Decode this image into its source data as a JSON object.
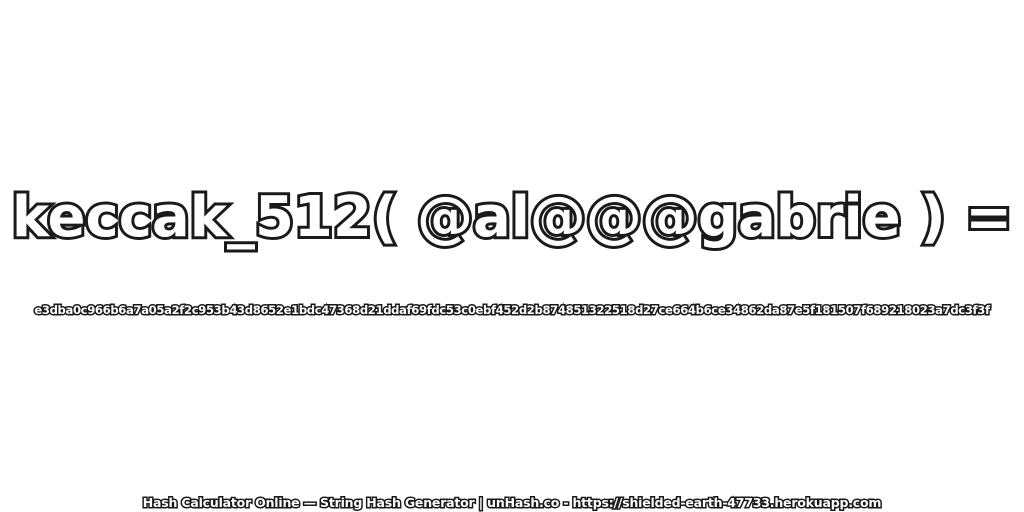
{
  "headline": "keccak_512( @al@@@gabrie ) =",
  "hash_value": "e3dba0c966b6a7a05a2f2c953b43d8652e1bdc47368d21ddaf69fdc53c0ebf452d2b874851322518d27ce664b6ce34862da87e5f181507f689218023a7dc3f3f",
  "footer": "Hash Calculator Online — String Hash Generator | unHash.co - https://shielded-earth-47733.herokuapp.com",
  "colors": {
    "background": "#ffffff",
    "text_fill": "#ffffff",
    "text_outline": "#1a1a1a"
  }
}
